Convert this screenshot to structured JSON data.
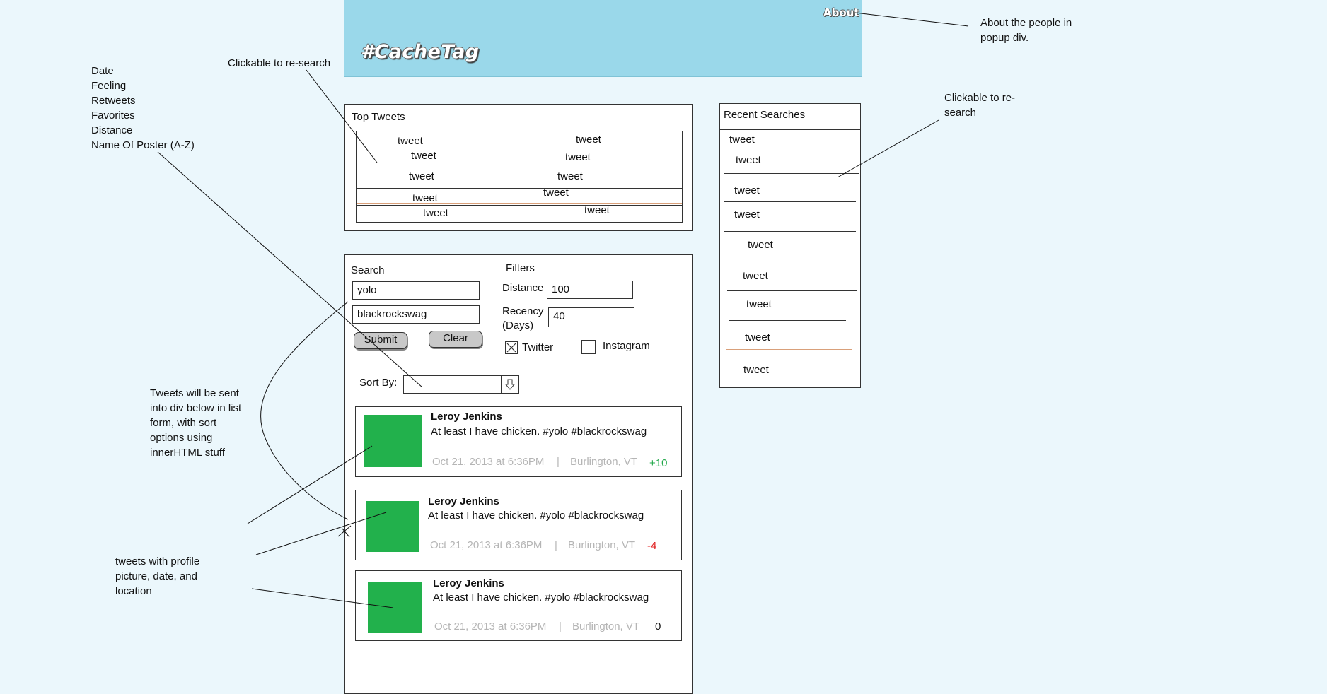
{
  "header": {
    "logo": "#CacheTag",
    "about_link": "About"
  },
  "annotations": {
    "about_note": [
      "About the people in",
      "popup div."
    ],
    "clickable_top": "Clickable to re-search",
    "clickable_right": [
      "Clickable to re-",
      "search"
    ],
    "sort_options": [
      "Date",
      "Feeling",
      "Retweets",
      "Favorites",
      "Distance",
      "Name Of Poster (A-Z)"
    ],
    "tweets_list_note": [
      "Tweets will be sent",
      "into div below in list",
      "form, with sort",
      "options using",
      "innerHTML stuff"
    ],
    "tweet_card_note": [
      "tweets with profile",
      "picture, date, and",
      "location"
    ]
  },
  "top_tweets": {
    "title": "Top Tweets",
    "left": [
      "tweet",
      "tweet",
      "tweet",
      "tweet",
      "tweet"
    ],
    "right": [
      "tweet",
      "tweet",
      "tweet",
      "tweet",
      "tweet"
    ]
  },
  "search": {
    "label": "Search",
    "query1": "yolo",
    "query2": "blackrockswag",
    "submit": "Submit",
    "clear": "Clear"
  },
  "filters": {
    "label": "Filters",
    "distance_label": "Distance",
    "distance_value": "100",
    "recency_label_1": "Recency",
    "recency_label_2": "(Days)",
    "recency_value": "40",
    "twitter_label": "Twitter",
    "twitter_checked": true,
    "instagram_label": "Instagram",
    "instagram_checked": false
  },
  "sort": {
    "label": "Sort By:",
    "value": ""
  },
  "tweets": [
    {
      "name": "Leroy Jenkins",
      "text": "At least I have chicken. #yolo #blackrockswag",
      "date": "Oct 21, 2013 at 6:36PM",
      "location": "Burlington, VT",
      "score": "+10",
      "score_color": "#22a84a"
    },
    {
      "name": "Leroy Jenkins",
      "text": "At least I have chicken. #yolo #blackrockswag",
      "date": "Oct 21, 2013 at 6:36PM",
      "location": "Burlington, VT",
      "score": "-4",
      "score_color": "#e02020"
    },
    {
      "name": "Leroy Jenkins",
      "text": "At least I have chicken. #yolo #blackrockswag",
      "date": "Oct 21, 2013 at 6:36PM",
      "location": "Burlington, VT",
      "score": "0",
      "score_color": "#111111"
    }
  ],
  "recent": {
    "title": "Recent Searches",
    "items": [
      "tweet",
      "tweet",
      "tweet",
      "tweet",
      "tweet",
      "tweet",
      "tweet",
      "tweet",
      "tweet"
    ]
  },
  "colors": {
    "background": "#ebf7fc",
    "header": "#9ad8ea",
    "avatar": "#22b14c"
  }
}
